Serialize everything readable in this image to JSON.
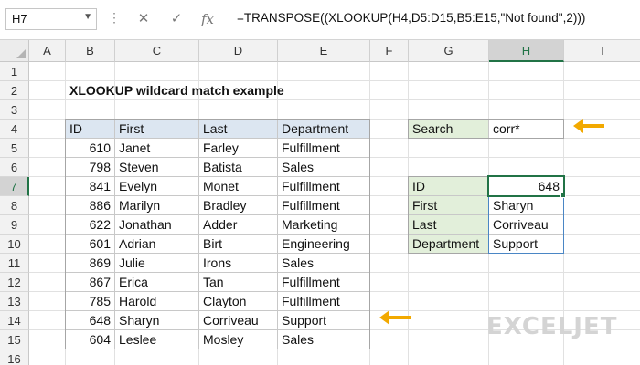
{
  "formula_bar": {
    "name_box": "H7",
    "formula": "=TRANSPOSE((XLOOKUP(H4,D5:D15,B5:E15,\"Not found\",2)))"
  },
  "columns": [
    "A",
    "B",
    "C",
    "D",
    "E",
    "F",
    "G",
    "H",
    "I"
  ],
  "rows": [
    "1",
    "2",
    "3",
    "4",
    "5",
    "6",
    "7",
    "8",
    "9",
    "10",
    "11",
    "12",
    "13",
    "14",
    "15",
    "16"
  ],
  "sheet": {
    "title": "XLOOKUP wildcard match example",
    "table": {
      "headers": [
        "ID",
        "First",
        "Last",
        "Department"
      ],
      "rows": [
        [
          "610",
          "Janet",
          "Farley",
          "Fulfillment"
        ],
        [
          "798",
          "Steven",
          "Batista",
          "Sales"
        ],
        [
          "841",
          "Evelyn",
          "Monet",
          "Fulfillment"
        ],
        [
          "886",
          "Marilyn",
          "Bradley",
          "Fulfillment"
        ],
        [
          "622",
          "Jonathan",
          "Adder",
          "Marketing"
        ],
        [
          "601",
          "Adrian",
          "Birt",
          "Engineering"
        ],
        [
          "869",
          "Julie",
          "Irons",
          "Sales"
        ],
        [
          "867",
          "Erica",
          "Tan",
          "Fulfillment"
        ],
        [
          "785",
          "Harold",
          "Clayton",
          "Fulfillment"
        ],
        [
          "648",
          "Sharyn",
          "Corriveau",
          "Support"
        ],
        [
          "604",
          "Leslee",
          "Mosley",
          "Sales"
        ]
      ]
    },
    "search": {
      "label": "Search",
      "value": "corr*"
    },
    "result": {
      "labels": [
        "ID",
        "First",
        "Last",
        "Department"
      ],
      "values": [
        "648",
        "Sharyn",
        "Corriveau",
        "Support"
      ]
    }
  },
  "brand": "EXCELJET",
  "colors": {
    "header_blue": "#dce6f1",
    "label_green": "#e2efda",
    "accent_green": "#217346",
    "arrow": "#f2a900"
  }
}
